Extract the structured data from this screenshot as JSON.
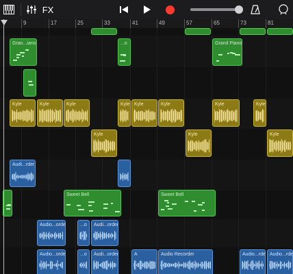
{
  "toolbar": {
    "piano_icon": "piano-keyboard-icon",
    "mixer_icon": "mixer-sliders-icon",
    "fx_label": "FX",
    "rewind_icon": "go-to-start-icon",
    "play_icon": "play-icon",
    "record_icon": "record-icon",
    "metronome_icon": "metronome-icon",
    "loop_icon": "loop-browser-icon",
    "volume_level": 0.96,
    "record_color": "#ff3b30"
  },
  "ruler": {
    "bars": [
      "9",
      "17",
      "25",
      "33",
      "41",
      "49",
      "57",
      "65",
      "73",
      "81"
    ]
  },
  "regions": {
    "grand1": "Gran...iano",
    "grand2": "...o",
    "grand3": "Grand Piano",
    "kyle": "Kyle",
    "audio_rec_short": "Audi...rder",
    "audio_rec_mid": "Audio...order",
    "audio_rec_3": "Audi...order",
    "audio_a": "A",
    "audio_recorder": "Audio Recorder",
    "audio_rec_end": "Audio...rder",
    "sweet_bell": "Sweet Bell"
  },
  "colors": {
    "midi_green": "#2f8c2f",
    "audio_blue": "#2a5fa0",
    "kyle_gold": "#8c7a15"
  }
}
